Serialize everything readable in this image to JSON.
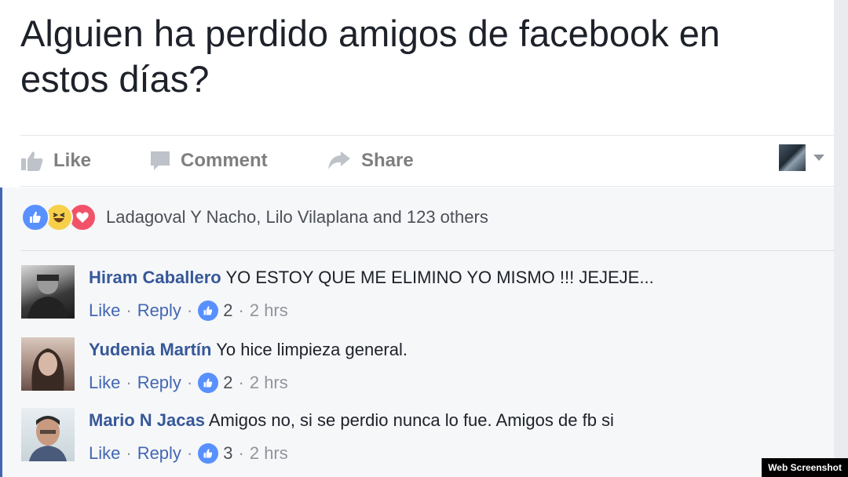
{
  "post": {
    "text": "Alguien ha perdido amigos de facebook en estos días?"
  },
  "actions": {
    "like_label": "Like",
    "comment_label": "Comment",
    "share_label": "Share"
  },
  "reactions": {
    "summary": "Ladagoval Y Nacho, Lilo Vilaplana and 123 others"
  },
  "comments": [
    {
      "author": "Hiram Caballero",
      "text": "YO ESTOY QUE ME ELIMINO YO MISMO !!! JEJEJE...",
      "like": "Like",
      "reply": "Reply",
      "sep": "·",
      "likes": "2",
      "time": "2 hrs"
    },
    {
      "author": "Yudenia Martín",
      "text": "Yo hice limpieza general.",
      "like": "Like",
      "reply": "Reply",
      "sep": "·",
      "likes": "2",
      "time": "2 hrs"
    },
    {
      "author": "Mario N Jacas",
      "text": "Amigos no, si se perdio nunca lo fue. Amigos de fb si",
      "like": "Like",
      "reply": "Reply",
      "sep": "·",
      "likes": "3",
      "time": "2 hrs"
    }
  ],
  "watermark": "Web Screenshot",
  "colors": {
    "link": "#365899",
    "accent": "#4267b2",
    "meta": "#90949c",
    "like_blue": "#5890ff"
  }
}
